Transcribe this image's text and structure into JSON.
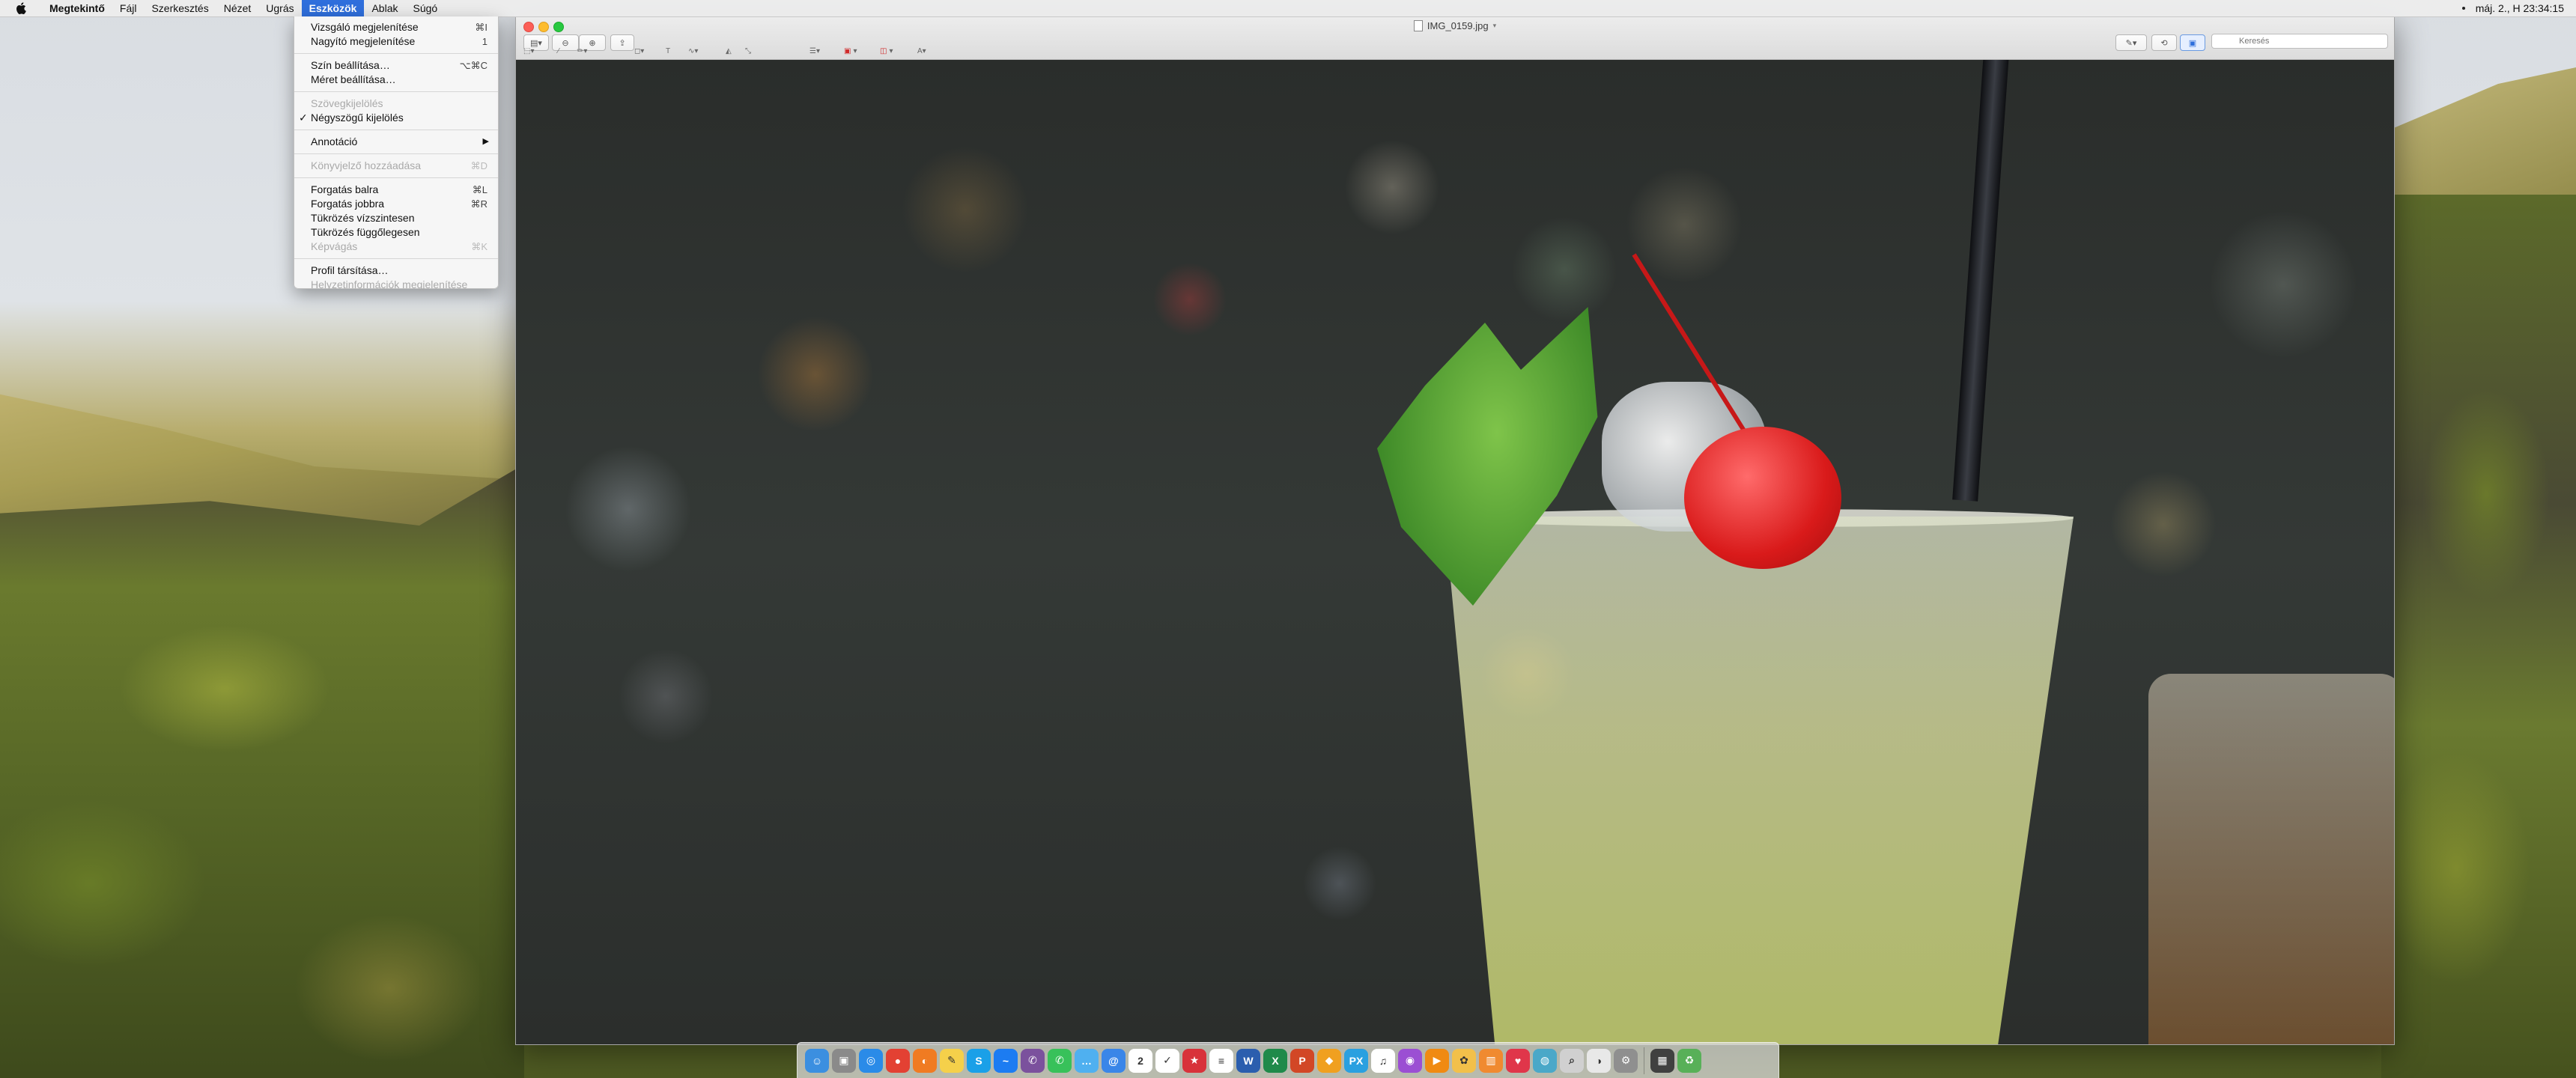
{
  "menubar": {
    "app_name": "Megtekintő",
    "items": [
      "Fájl",
      "Szerkesztés",
      "Nézet",
      "Ugrás",
      "Eszközök",
      "Ablak",
      "Súgó"
    ],
    "clock": "máj. 2., H  23:34:15"
  },
  "tools_menu": {
    "items": [
      {
        "label": "Vizsgáló megjelenítése",
        "shortcut": "⌘I",
        "enabled": true
      },
      {
        "label": "Nagyító megjelenítése",
        "shortcut": "1",
        "enabled": true
      },
      {
        "label": "Szín beállítása…",
        "shortcut": "⌥⌘C",
        "enabled": true
      },
      {
        "label": "Méret beállítása…",
        "shortcut": "",
        "enabled": true
      },
      {
        "label": "Szövegkijelölés",
        "shortcut": "",
        "enabled": false
      },
      {
        "label": "Négyszögű kijelölés",
        "shortcut": "",
        "enabled": true,
        "checked": true
      },
      {
        "label": "Annotáció",
        "shortcut": "",
        "enabled": true,
        "submenu": true
      },
      {
        "label": "Könyvjelző hozzáadása",
        "shortcut": "⌘D",
        "enabled": false
      },
      {
        "label": "Forgatás balra",
        "shortcut": "⌘L",
        "enabled": true
      },
      {
        "label": "Forgatás jobbra",
        "shortcut": "⌘R",
        "enabled": true
      },
      {
        "label": "Tükrözés vízszintesen",
        "shortcut": "",
        "enabled": true
      },
      {
        "label": "Tükrözés függőlegesen",
        "shortcut": "",
        "enabled": true
      },
      {
        "label": "Képvágás",
        "shortcut": "⌘K",
        "enabled": false
      },
      {
        "label": "Profil társítása…",
        "shortcut": "",
        "enabled": true
      },
      {
        "label": "Helyzetinformációk megjelenítése",
        "shortcut": "",
        "enabled": false
      }
    ]
  },
  "window": {
    "title": "IMG_0159.jpg",
    "search_placeholder": "Keresés"
  },
  "colors": {
    "accent": "#2f6fdc",
    "close": "#fc5f57",
    "minimize": "#fdbc2e",
    "zoom": "#28c840"
  },
  "dock": {
    "apps": [
      {
        "name": "finder-icon",
        "color": "#3b8fe0"
      },
      {
        "name": "disk-icon",
        "color": "#8a8a8a"
      },
      {
        "name": "safari-icon",
        "color": "#2a8be8"
      },
      {
        "name": "chrome-icon",
        "color": "#e34133"
      },
      {
        "name": "firefox-icon",
        "color": "#f07b22"
      },
      {
        "name": "notes-icon",
        "color": "#f5d04a"
      },
      {
        "name": "skype-icon",
        "color": "#1aa0e8"
      },
      {
        "name": "messenger-icon",
        "color": "#1c7cf2"
      },
      {
        "name": "viber-icon",
        "color": "#7b519d"
      },
      {
        "name": "phone-icon",
        "color": "#38c15a"
      },
      {
        "name": "messages-icon",
        "color": "#4fb0f0"
      },
      {
        "name": "mail-icon",
        "color": "#3a86e8"
      },
      {
        "name": "calendar-icon",
        "color": "#ffffff"
      },
      {
        "name": "reminders-icon",
        "color": "#ffffff"
      },
      {
        "name": "wunderlist-icon",
        "color": "#d8323a"
      },
      {
        "name": "textedit-icon",
        "color": "#ffffff"
      },
      {
        "name": "word-icon",
        "color": "#2b5eae"
      },
      {
        "name": "excel-icon",
        "color": "#1f8a4a"
      },
      {
        "name": "powerpoint-icon",
        "color": "#d24726"
      },
      {
        "name": "sketch-icon",
        "color": "#f0a020"
      },
      {
        "name": "pixelmator-icon",
        "color": "#2aa0e0"
      },
      {
        "name": "itunes-icon",
        "color": "#ffffff"
      },
      {
        "name": "podcasts-icon",
        "color": "#9b4fd3"
      },
      {
        "name": "vlc-icon",
        "color": "#f08a12"
      },
      {
        "name": "photos-icon",
        "color": "#f2c04a"
      },
      {
        "name": "books-icon",
        "color": "#f08a30"
      },
      {
        "name": "pocket-icon",
        "color": "#e0364a"
      },
      {
        "name": "system-icon",
        "color": "#4aa8c8"
      },
      {
        "name": "magnifier-icon",
        "color": "#d0d0d0"
      },
      {
        "name": "activity-icon",
        "color": "#e8e8e8"
      },
      {
        "name": "settings-icon",
        "color": "#8f8f8f"
      },
      {
        "name": "screenshot-icon",
        "color": "#404040"
      },
      {
        "name": "trash-icon",
        "color": "#58b058"
      }
    ],
    "glyphs": [
      "☺",
      "▣",
      "◎",
      "●",
      "◐",
      "✎",
      "S",
      "~",
      "✆",
      "✆",
      "…",
      "@",
      "2",
      "✓",
      "★",
      "≡",
      "W",
      "X",
      "P",
      "◆",
      "PX",
      "♫",
      "◉",
      "▶",
      "✿",
      "▥",
      "♥",
      "◍",
      "⌕",
      "◑",
      "⚙",
      "▦",
      "♻"
    ]
  }
}
